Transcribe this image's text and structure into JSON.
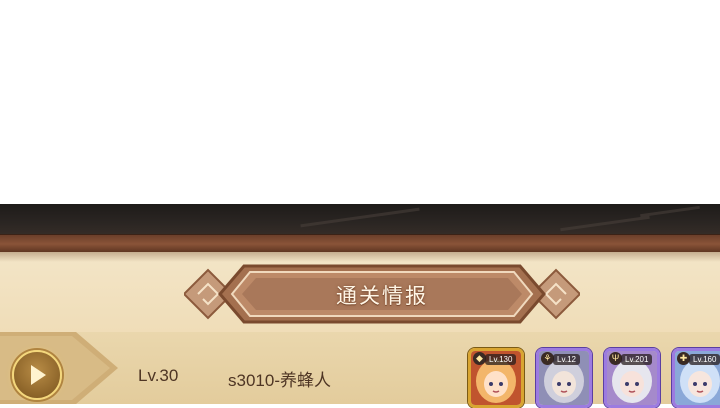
{
  "banner": {
    "title": "通关情报"
  },
  "record": {
    "level": "Lv.30",
    "stage_player": "s3010-养蜂人"
  },
  "heroes": [
    {
      "level": "Lv.130",
      "class_icon": "shield-icon",
      "frame": "gold",
      "palette": {
        "bg": "#c0542e",
        "hair": "#f3b66a",
        "skin": "#ffe1c8"
      }
    },
    {
      "level": "Lv.12",
      "class_icon": "leaf-icon",
      "frame": "purple",
      "palette": {
        "bg": "#8f8fb6",
        "hair": "#cfcfdc",
        "skin": "#f2e4da"
      }
    },
    {
      "level": "Lv.201",
      "class_icon": "trident-icon",
      "frame": "purple",
      "palette": {
        "bg": "#a58acb",
        "hair": "#e6e6ee",
        "skin": "#f7e2db"
      }
    },
    {
      "level": "Lv.160",
      "class_icon": "cross-icon",
      "frame": "purple",
      "palette": {
        "bg": "#8aa8d8",
        "hair": "#cfe0f7",
        "skin": "#f7e6de"
      }
    }
  ]
}
